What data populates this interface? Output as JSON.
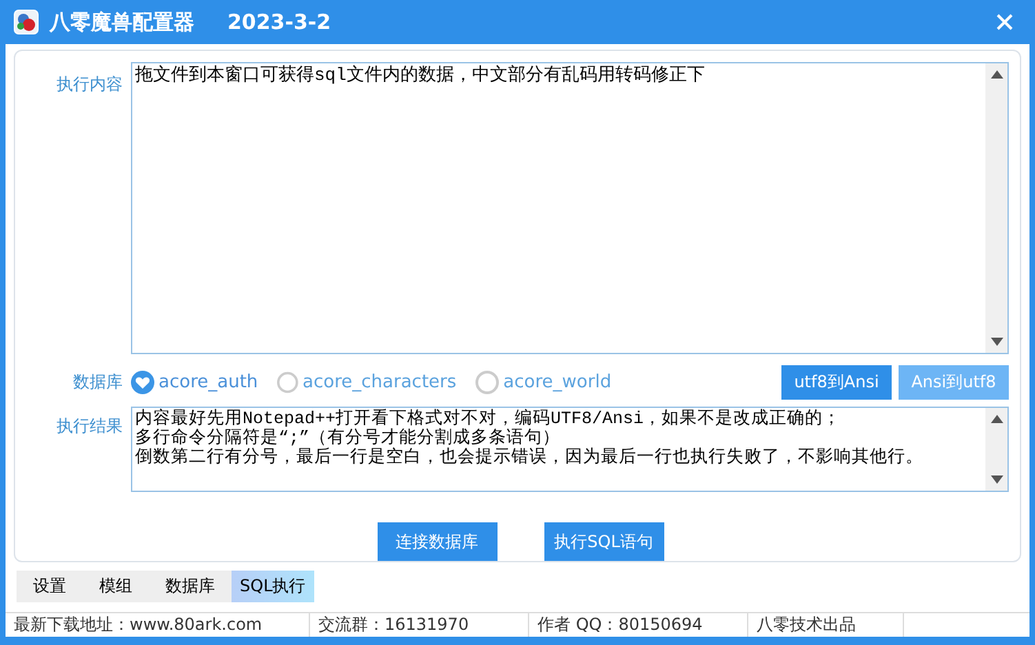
{
  "window": {
    "title": "八零魔兽配置器",
    "version": "2023-3-2"
  },
  "content": {
    "label": "执行内容",
    "text": "拖文件到本窗口可获得sql文件内的数据，中文部分有乱码用转码修正下"
  },
  "database": {
    "label": "数据库",
    "options": [
      {
        "label": "acore_auth",
        "selected": true
      },
      {
        "label": "acore_characters",
        "selected": false
      },
      {
        "label": "acore_world",
        "selected": false
      }
    ]
  },
  "convert_buttons": [
    {
      "label": "utf8到Ansi",
      "disabled": false
    },
    {
      "label": "Ansi到utf8",
      "disabled": true
    }
  ],
  "result": {
    "label": "执行结果",
    "lines": [
      "内容最好先用Notepad++打开看下格式对不对，编码UTF8/Ansi，如果不是改成正确的；",
      "多行命令分隔符是“;”（有分号才能分割成多条语句）",
      "倒数第二行有分号，最后一行是空白，也会提示错误，因为最后一行也执行失败了，不影响其他行。"
    ]
  },
  "action_buttons": [
    "连接数据库",
    "执行SQL语句"
  ],
  "tabs": [
    {
      "label": "设置",
      "selected": false
    },
    {
      "label": "模组",
      "selected": false
    },
    {
      "label": "数据库",
      "selected": false
    },
    {
      "label": "SQL执行",
      "selected": true
    }
  ],
  "status_bar": [
    "最新下载地址：www.80ark.com",
    "交流群：16131970",
    "作者 QQ：80150694",
    "八零技术出品"
  ]
}
